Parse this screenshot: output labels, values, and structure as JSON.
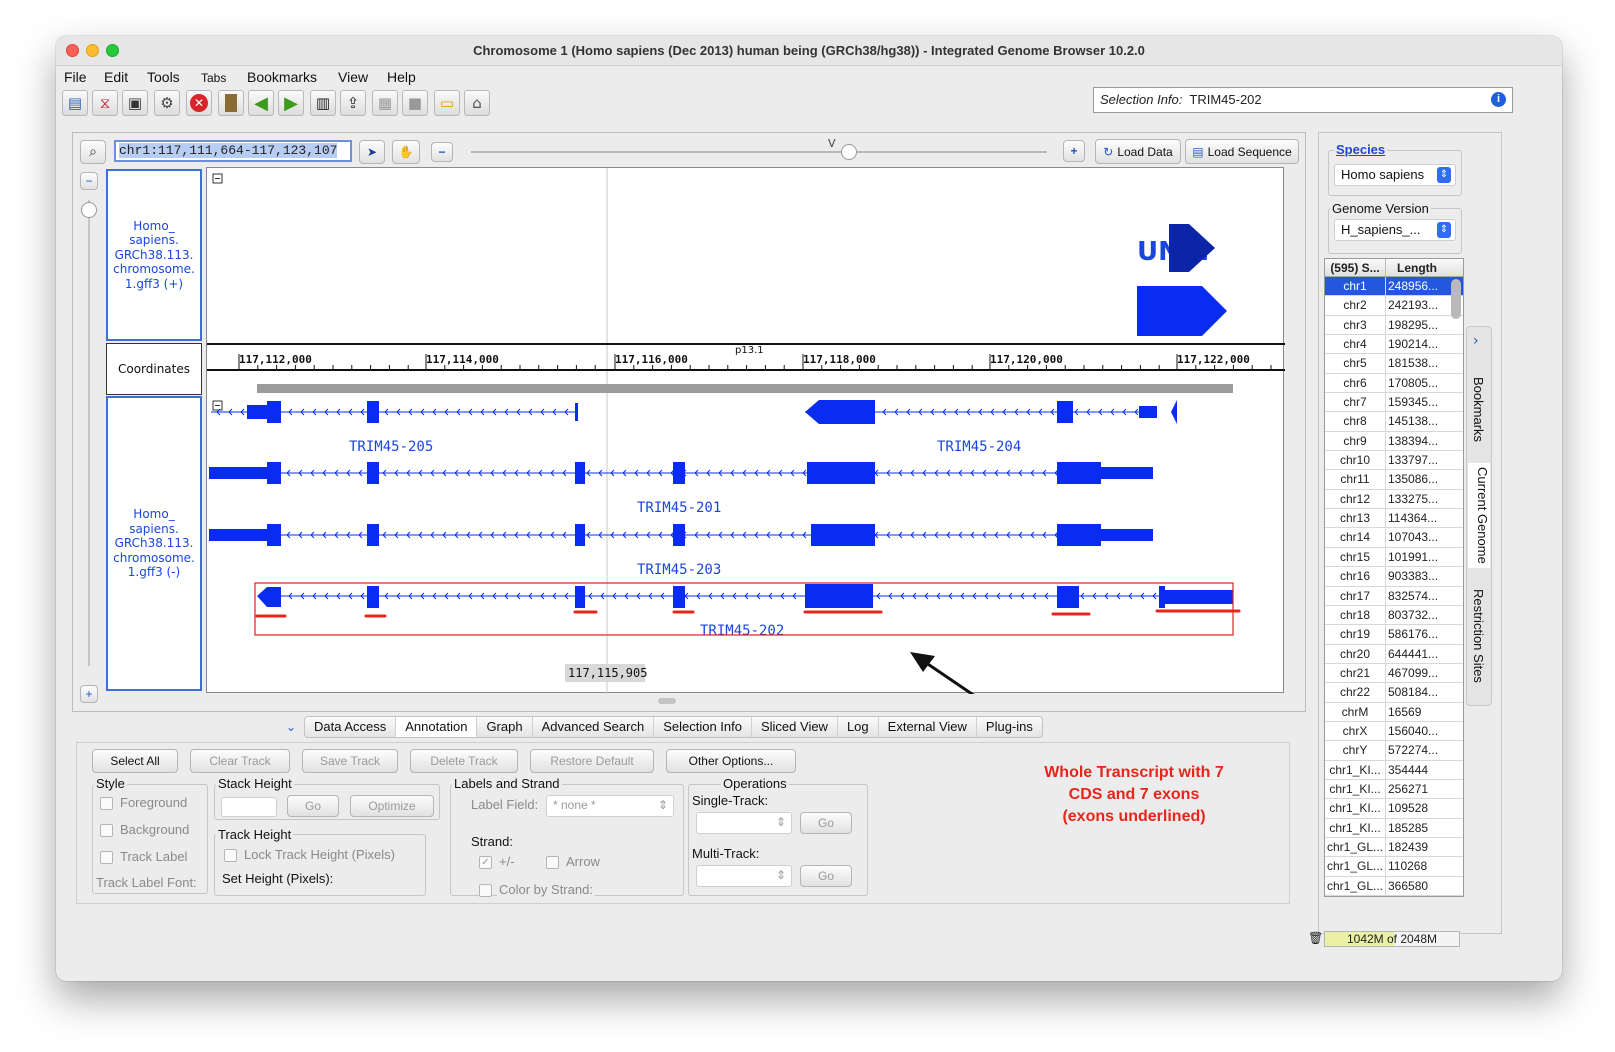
{
  "window": {
    "title": "Chromosome 1  (Homo sapiens (Dec 2013) human being (GRCh38/hg38)) - Integrated Genome Browser 10.2.0"
  },
  "menu": [
    "File",
    "Edit",
    "Tools",
    "Tabs",
    "Bookmarks",
    "View",
    "Help"
  ],
  "toolbar": {
    "icons": [
      "open-folder-icon",
      "dna-icon",
      "camera-icon",
      "gear-icon",
      "stop-icon",
      "bookmark-icon",
      "arrow-left-icon",
      "arrow-right-icon",
      "film-icon",
      "upload-icon",
      "grid-icon",
      "panel-icon",
      "comment-icon",
      "home-icon"
    ],
    "selection_label": "Selection Info:",
    "selection_value": "TRIM45-202"
  },
  "location": {
    "value": "chr1:117,111,664-117,123,107"
  },
  "controls": {
    "load_data": "Load Data",
    "load_sequence": "Load Sequence"
  },
  "tracks": {
    "plus_track": "Homo_ sapiens. GRCh38.113. chromosome. 1.gff3 (+)",
    "coords_track": "Coordinates",
    "minus_track": "Homo_ sapiens. GRCh38.113. chromosome. 1.gff3 (-)",
    "band_label": "p13.1",
    "unk_label": "UN...",
    "ticks": [
      "117,112,000",
      "117,114,000",
      "117,116,000",
      "117,118,000",
      "117,120,000",
      "117,122,000"
    ],
    "cursor_pos": "117,115,905",
    "transcripts": [
      "TRIM45-205",
      "TRIM45-204",
      "TRIM45-201",
      "TRIM45-203",
      "TRIM45-202"
    ]
  },
  "bottom_tabs": [
    "Data Access",
    "Annotation",
    "Graph",
    "Advanced Search",
    "Selection Info",
    "Sliced View",
    "Log",
    "External View",
    "Plug-ins"
  ],
  "annotation": {
    "select_all": "Select All",
    "clear_track": "Clear Track",
    "save_track": "Save Track",
    "delete_track": "Delete Track",
    "restore_default": "Restore Default",
    "other_options": "Other Options...",
    "style": "Style",
    "foreground": "Foreground",
    "background": "Background",
    "track_label": "Track Label",
    "track_label_font": "Track Label Font:",
    "stack_height": "Stack Height",
    "go": "Go",
    "optimize": "Optimize",
    "track_height": "Track Height",
    "lock_track_height": "Lock Track Height (Pixels)",
    "set_height": "Set Height (Pixels):",
    "labels_strand": "Labels and Strand",
    "label_field": "Label Field:",
    "label_field_value": "* none *",
    "strand": "Strand:",
    "plus_minus": "+/-",
    "arrow": "Arrow",
    "color_by_strand": "Color by Strand:",
    "operations": "Operations",
    "single_track": "Single-Track:",
    "multi_track": "Multi-Track:"
  },
  "side": {
    "species_label": "Species",
    "species_value": "Homo sapiens",
    "genome_label": "Genome Version",
    "genome_value": "H_sapiens_...",
    "seq_header_name": "(595) S...",
    "seq_header_len": "Length",
    "sequences": [
      [
        "chr1",
        "248956..."
      ],
      [
        "chr2",
        "242193..."
      ],
      [
        "chr3",
        "198295..."
      ],
      [
        "chr4",
        "190214..."
      ],
      [
        "chr5",
        "181538..."
      ],
      [
        "chr6",
        "170805..."
      ],
      [
        "chr7",
        "159345..."
      ],
      [
        "chr8",
        "145138..."
      ],
      [
        "chr9",
        "138394..."
      ],
      [
        "chr10",
        "133797..."
      ],
      [
        "chr11",
        "135086..."
      ],
      [
        "chr12",
        "133275..."
      ],
      [
        "chr13",
        "114364..."
      ],
      [
        "chr14",
        "107043..."
      ],
      [
        "chr15",
        "101991..."
      ],
      [
        "chr16",
        "903383..."
      ],
      [
        "chr17",
        "832574..."
      ],
      [
        "chr18",
        "803732..."
      ],
      [
        "chr19",
        "586176..."
      ],
      [
        "chr20",
        "644441..."
      ],
      [
        "chr21",
        "467099..."
      ],
      [
        "chr22",
        "508184..."
      ],
      [
        "chrM",
        "16569"
      ],
      [
        "chrX",
        "156040..."
      ],
      [
        "chrY",
        "572274..."
      ],
      [
        "chr1_KI...",
        "354444"
      ],
      [
        "chr1_KI...",
        "256271"
      ],
      [
        "chr1_KI...",
        "109528"
      ],
      [
        "chr1_KI...",
        "185285"
      ],
      [
        "chr1_GL...",
        "182439"
      ],
      [
        "chr1_GL...",
        "110268"
      ],
      [
        "chr1_GL...",
        "366580"
      ]
    ],
    "vtabs": [
      "Bookmarks",
      "Current Genome",
      "Restriction Sites"
    ]
  },
  "status": {
    "memory": "1042M of 2048M"
  },
  "annotation_note": {
    "line1": "Whole Transcript with 7",
    "line2": "CDS and 7 exons",
    "line3": "(exons underlined)"
  },
  "colors": {
    "feature": "#0a2cf0",
    "accent": "#2456e0",
    "note": "#e8251a"
  }
}
